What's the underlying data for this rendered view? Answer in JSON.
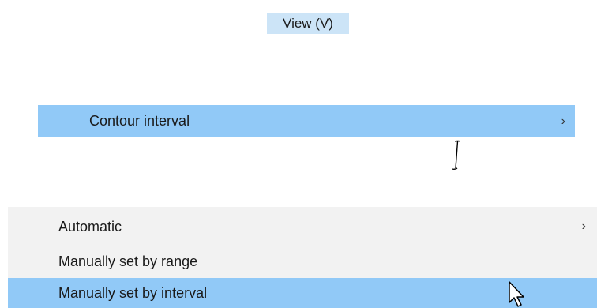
{
  "menubar": {
    "view_label": "View (V)"
  },
  "view_menu": {
    "contour_interval_label": "Contour interval",
    "submenu_arrow": "›"
  },
  "contour_submenu": {
    "items": [
      {
        "label": "Automatic",
        "arrow": "›"
      },
      {
        "label": "Manually set by range"
      },
      {
        "label": "Manually set by interval"
      }
    ]
  },
  "colors": {
    "menubar_highlight": "#cce4f7",
    "item_highlight": "#91c9f7",
    "submenu_background": "#f2f2f2"
  },
  "icons": {
    "text_cursor": "ibeam-cursor-icon",
    "pointer": "arrow-pointer-icon"
  }
}
